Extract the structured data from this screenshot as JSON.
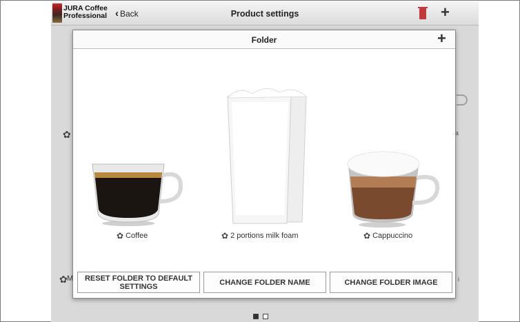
{
  "app": {
    "brand_line1": "JURA Coffee",
    "brand_line2": "Professional",
    "back_label": "Back",
    "title": "Product settings",
    "accent": "#c03a3a"
  },
  "background": {
    "fragment_a": "a",
    "fragment_i": "i",
    "fragment_m": "M"
  },
  "modal": {
    "title": "Folder",
    "products": [
      {
        "label": "Coffee",
        "icon": "espresso-cup"
      },
      {
        "label": "2 portions milk foam",
        "icon": "milk-glasses"
      },
      {
        "label": "Cappuccino",
        "icon": "cappuccino-cup"
      }
    ],
    "buttons": {
      "reset": "RESET FOLDER TO DEFAULT SETTINGS",
      "rename": "CHANGE FOLDER NAME",
      "image": "CHANGE FOLDER IMAGE"
    }
  },
  "pagination": {
    "pages": 2,
    "current": 1
  }
}
